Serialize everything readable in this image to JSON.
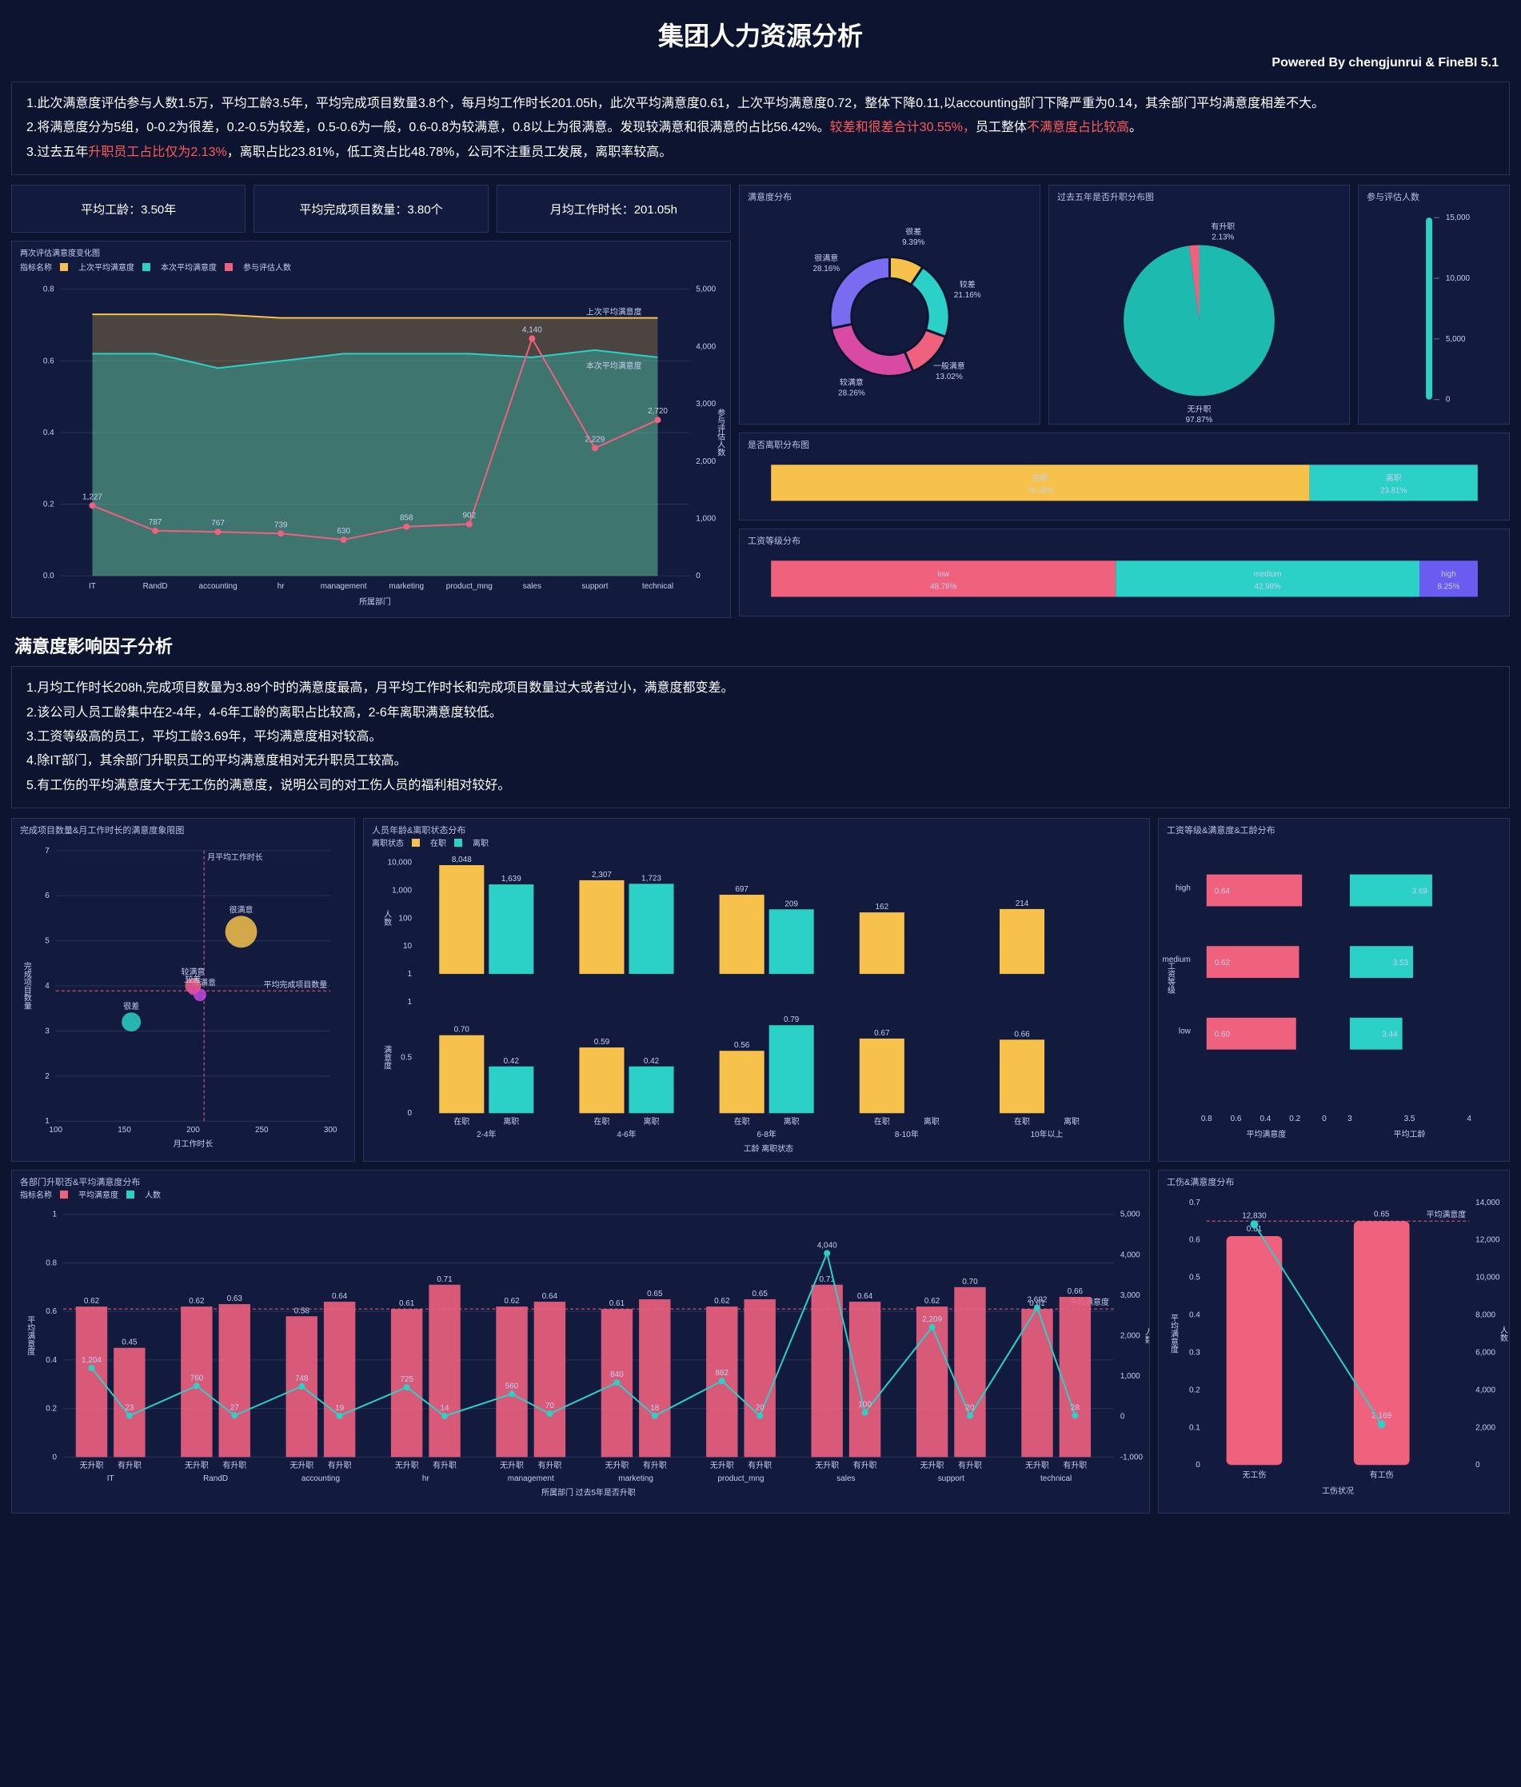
{
  "header": {
    "title": "集团人力资源分析",
    "powered": "Powered By chengjunrui & FineBI 5.1"
  },
  "intro": {
    "l1a": "1.此次满意度评估参与人数1.5万，平均工龄3.5年，平均完成项目数量3.8个，每月均工作时长201.05h，此次平均满意度0.61，上次平均满意度0.72，整体下降0.11,以accounting部门下降严重为0.14，其余部门平均满意度相差不大。",
    "l2a": "2.将满意度分为5组，0-0.2为很差，0.2-0.5为较差，0.5-0.6为一般，0.6-0.8为较满意，0.8以上为很满意。发现较满意和很满意的占比56.42%。",
    "l2b": "较差和很差合计30.55%，",
    "l2c": "员工整体",
    "l2d": "不满意度占比较高",
    "l2e": "。",
    "l3a": "3.过去五年",
    "l3b": "升职员工占比仅为2.13%",
    "l3c": "，离职占比23.81%，低工资占比48.78%，公司不注重员工发展，离职率较高。"
  },
  "kpi": {
    "a": "平均工龄：3.50年",
    "b": "平均完成项目数量：3.80个",
    "c": "月均工作时长：201.05h"
  },
  "titles": {
    "linebar": "两次评估满意度变化图",
    "donut": "满意度分布",
    "pie": "过去五年是否升职分布图",
    "gauge": "参与评估人数",
    "bar1": "是否离职分布图",
    "bar2": "工资等级分布",
    "h2": "满意度影响因子分析",
    "scatter": "完成项目数量&月工作时长的满意度象限图",
    "age": "人员年龄&离职状态分布",
    "salary": "工资等级&满意度&工龄分布",
    "dept": "各部门升职否&平均满意度分布",
    "injury": "工伤&满意度分布"
  },
  "factors": {
    "l1": "1.月均工作时长208h,完成项目数量为3.89个时的满意度最高，月平均工作时长和完成项目数量过大或者过小，满意度都变差。",
    "l2": "2.该公司人员工龄集中在2-4年，4-6年工龄的离职占比较高，2-6年离职满意度较低。",
    "l3": "3.工资等级高的员工，平均工龄3.69年，平均满意度相对较高。",
    "l4": "4.除IT部门，其余部门升职员工的平均满意度相对无升职员工较高。",
    "l5": "5.有工伤的平均满意度大于无工伤的满意度，说明公司的对工伤人员的福利相对较好。"
  },
  "chart_data": {
    "linebar": {
      "type": "combo",
      "xlabel": "所属部门",
      "categories": [
        "IT",
        "RandD",
        "accounting",
        "hr",
        "management",
        "marketing",
        "product_mng",
        "sales",
        "support",
        "technical"
      ],
      "series": [
        {
          "name": "上次平均满意度",
          "type": "line",
          "values": [
            0.73,
            0.73,
            0.73,
            0.72,
            0.72,
            0.72,
            0.72,
            0.72,
            0.72,
            0.72
          ]
        },
        {
          "name": "本次平均满意度",
          "type": "line",
          "values": [
            0.62,
            0.62,
            0.58,
            0.6,
            0.62,
            0.62,
            0.62,
            0.61,
            0.63,
            0.61
          ]
        },
        {
          "name": "参与评估人数",
          "type": "line",
          "values": [
            1227,
            787,
            767,
            739,
            630,
            858,
            902,
            4140,
            2229,
            2720
          ]
        }
      ],
      "ylim_left": [
        0,
        0.8
      ],
      "ylim_right": [
        0,
        5000
      ],
      "ref_lines": [
        {
          "label": "上次平均满意度",
          "y": 0.72
        },
        {
          "label": "本次平均满意度",
          "y": 0.61
        }
      ]
    },
    "donut": {
      "type": "pie",
      "slices": [
        {
          "label": "很差",
          "value": 9.39,
          "color": "#f6c24b"
        },
        {
          "label": "较差",
          "value": 21.16,
          "color": "#2bd1c7"
        },
        {
          "label": "一般满意",
          "value": 13.02,
          "color": "#f0617e"
        },
        {
          "label": "较满意",
          "value": 28.26,
          "color": "#d84aa4"
        },
        {
          "label": "很满意",
          "value": 28.16,
          "color": "#7a6cf0"
        }
      ]
    },
    "pie": {
      "type": "pie",
      "slices": [
        {
          "label": "无升职",
          "value": 97.87,
          "color": "#1dbab0"
        },
        {
          "label": "有升职",
          "value": 2.13,
          "color": "#f0617e"
        }
      ]
    },
    "gauge": {
      "type": "gauge",
      "value": 15000,
      "ticks": [
        0,
        5000,
        10000,
        15000
      ]
    },
    "bar_leave": {
      "type": "stacked_bar",
      "series": [
        {
          "name": "在职",
          "value": 76.19,
          "color": "#f6c24b"
        },
        {
          "name": "离职",
          "value": 23.81,
          "color": "#2bd1c7"
        }
      ]
    },
    "bar_salary": {
      "type": "stacked_bar",
      "series": [
        {
          "name": "low",
          "value": 48.78,
          "color": "#f0617e"
        },
        {
          "name": "medium",
          "value": 42.98,
          "color": "#2bd1c7"
        },
        {
          "name": "high",
          "value": 8.25,
          "color": "#6a5cf0"
        }
      ]
    },
    "scatter": {
      "type": "scatter",
      "xlabel": "月工作时长",
      "ylabel": "完成项目数量",
      "xlim": [
        100,
        300
      ],
      "ylim": [
        1,
        7
      ],
      "points": [
        {
          "label": "很差",
          "x": 155,
          "y": 3.2,
          "size": 6,
          "color": "#2bd1c7"
        },
        {
          "label": "一般满意",
          "x": 205,
          "y": 3.8,
          "size": 4,
          "color": "#c24ae0"
        },
        {
          "label": "较满意",
          "x": 200,
          "y": 4.0,
          "size": 5,
          "color": "#f0617e"
        },
        {
          "label": "很满意",
          "x": 235,
          "y": 5.2,
          "size": 10,
          "color": "#f6c24b"
        },
        {
          "label": "较差",
          "x": 200,
          "y": 3.9,
          "size": 3,
          "color": "#d84aa4"
        }
      ],
      "ref_x": 208,
      "ref_y": 3.89,
      "ref_x_label": "月平均工作时长",
      "ref_y_label": "平均完成项目数量"
    },
    "age": {
      "type": "grouped_bar",
      "xlabel": "工龄 离职状态",
      "left_ylabel": "人数",
      "right_ylabel": "满意度",
      "categories": [
        "2-4年",
        "4-6年",
        "6-8年",
        "8-10年",
        "10年以上"
      ],
      "count": {
        "在职": [
          8048,
          2307,
          697,
          162,
          214
        ],
        "离职": [
          1639,
          1723,
          209,
          0,
          0
        ]
      },
      "sat": {
        "在职": [
          0.7,
          0.59,
          0.56,
          0.67,
          0.66
        ],
        "离职": [
          0.42,
          0.42,
          0.79,
          null,
          null
        ]
      }
    },
    "salary_grid": {
      "type": "bar",
      "categories": [
        "high",
        "medium",
        "low"
      ],
      "ylabel": "工资等级",
      "left": {
        "label": "平均满意度",
        "xlim": [
          0,
          0.8
        ],
        "values": [
          0.64,
          0.62,
          0.6
        ],
        "color": "#f0617e"
      },
      "right": {
        "label": "平均工龄",
        "xlim": [
          3,
          4
        ],
        "values": [
          3.69,
          3.53,
          3.44
        ],
        "color": "#2bd1c7"
      }
    },
    "dept": {
      "type": "grouped",
      "xlabel": "所属部门 过去5年是否升职",
      "categories": [
        "IT",
        "RandD",
        "accounting",
        "hr",
        "management",
        "marketing",
        "product_mng",
        "sales",
        "support",
        "technical"
      ],
      "sat_no": [
        0.62,
        0.62,
        0.58,
        0.61,
        0.62,
        0.61,
        0.62,
        0.71,
        0.62,
        0.61
      ],
      "sat_yes": [
        0.45,
        0.63,
        0.64,
        0.71,
        0.64,
        0.65,
        0.65,
        0.64,
        0.7,
        0.66
      ],
      "count_no": [
        1204,
        760,
        748,
        725,
        560,
        840,
        882,
        4040,
        2209,
        2692
      ],
      "count_yes": [
        23,
        27,
        19,
        14,
        70,
        18,
        20,
        100,
        20,
        28
      ],
      "ref_label": "平均满意度",
      "ylim_left": [
        0,
        1
      ],
      "ylim_right": [
        -1000,
        5000
      ]
    },
    "injury": {
      "type": "combo",
      "xlabel": "工伤状况",
      "categories": [
        "无工伤",
        "有工伤"
      ],
      "sat": [
        0.61,
        0.65
      ],
      "count": [
        12830,
        2169
      ],
      "ref": 0.65,
      "ref_label": "平均满意度",
      "ylim_left": [
        0,
        0.7
      ],
      "ylim_right": [
        0,
        14000
      ]
    }
  }
}
